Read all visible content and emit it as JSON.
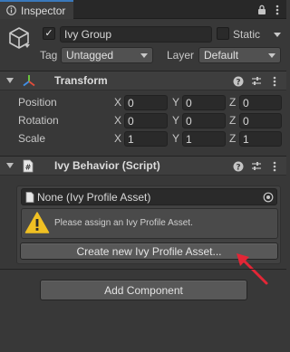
{
  "window": {
    "tab_label": "Inspector"
  },
  "gameobject": {
    "name": "Ivy Group",
    "static_label": "Static",
    "tag_label": "Tag",
    "tag_value": "Untagged",
    "layer_label": "Layer",
    "layer_value": "Default"
  },
  "transform": {
    "title": "Transform",
    "rows": [
      {
        "label": "Position",
        "x": "0",
        "y": "0",
        "z": "0"
      },
      {
        "label": "Rotation",
        "x": "0",
        "y": "0",
        "z": "0"
      },
      {
        "label": "Scale",
        "x": "1",
        "y": "1",
        "z": "1"
      }
    ],
    "axis": {
      "x": "X",
      "y": "Y",
      "z": "Z"
    }
  },
  "ivy_behavior": {
    "title": "Ivy Behavior (Script)",
    "profile_field": "None (Ivy Profile Asset)",
    "help_message": "Please assign an Ivy Profile Asset.",
    "create_button": "Create new Ivy Profile Asset..."
  },
  "add_component": {
    "label": "Add Component"
  },
  "colors": {
    "panel_bg": "#383838",
    "tab_accent": "#3a79bb",
    "warning": "#f0c023",
    "annotation_arrow": "#e32636"
  }
}
